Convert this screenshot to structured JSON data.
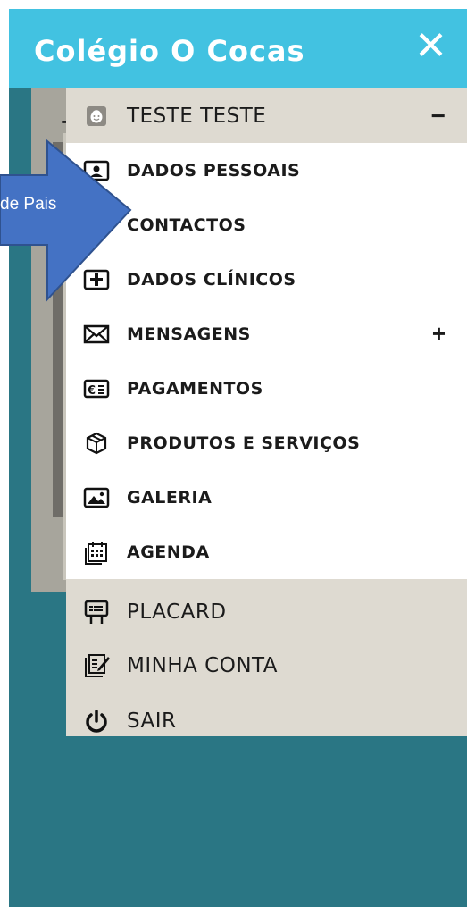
{
  "app": {
    "title": "Colégio O Cocas",
    "close_glyph": "✕"
  },
  "background": {
    "card_title_letter": "T"
  },
  "student": {
    "name": "TESTE TESTE",
    "collapse_glyph": "−"
  },
  "menu": {
    "items": [
      {
        "label": "DADOS PESSOAIS",
        "icon": "id-card-icon"
      },
      {
        "label": "CONTACTOS",
        "icon": "contacts-icon"
      },
      {
        "label": "DADOS CLÍNICOS",
        "icon": "medical-plus-icon"
      },
      {
        "label": "MENSAGENS",
        "icon": "envelope-icon",
        "expand": "+"
      },
      {
        "label": "PAGAMENTOS",
        "icon": "euro-bill-icon"
      },
      {
        "label": "PRODUTOS E SERVIÇOS",
        "icon": "box-icon"
      },
      {
        "label": "GALERIA",
        "icon": "picture-icon"
      },
      {
        "label": "AGENDA",
        "icon": "calendar-icon"
      }
    ],
    "footer": [
      {
        "label": "PLACARD",
        "icon": "board-icon"
      },
      {
        "label": "MINHA CONTA",
        "icon": "account-edit-icon"
      },
      {
        "label": "SAIR",
        "icon": "power-icon"
      }
    ]
  },
  "annotation": {
    "text": "de Pais"
  },
  "colors": {
    "header": "#42c2e1",
    "backdrop": "#2a7684",
    "section_beige": "#dedad1",
    "arrow_fill": "#4472c4",
    "arrow_stroke": "#2f528f"
  }
}
